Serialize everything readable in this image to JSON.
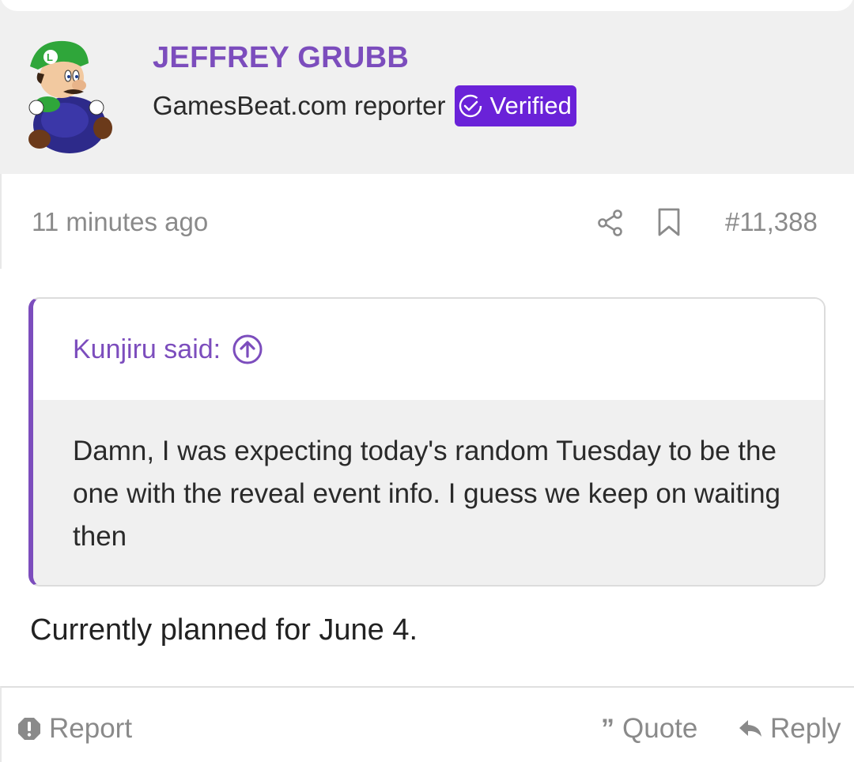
{
  "user": {
    "name": "JEFFREY GRUBB",
    "title": "GamesBeat.com reporter",
    "badge": "Verified",
    "avatar_icon": "luigi-avatar"
  },
  "meta": {
    "time": "11 minutes ago",
    "post_number": "#11,388"
  },
  "quote": {
    "author": "Kunjiru said:",
    "text": "Damn, I was expecting today's random Tuesday to be the one with the reveal event info. I guess we keep on waiting then"
  },
  "post": {
    "body": "Currently planned for June 4."
  },
  "footer": {
    "report": "Report",
    "quote": "Quote",
    "reply": "Reply"
  },
  "colors": {
    "accent": "#7c4dbd",
    "badge": "#6a22d8",
    "muted": "#8a8a8a",
    "panel": "#f0f0f0"
  }
}
